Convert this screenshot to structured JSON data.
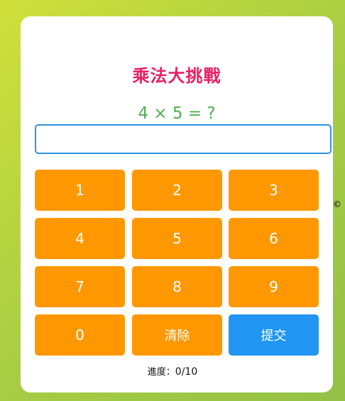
{
  "app": {
    "title": "乘法大挑戰"
  },
  "question": {
    "text": "4 × 5 = ?"
  },
  "answer_input": {
    "value": "",
    "placeholder": ""
  },
  "keypad": {
    "keys": [
      "1",
      "2",
      "3",
      "4",
      "5",
      "6",
      "7",
      "8",
      "9",
      "0"
    ],
    "clear_label": "清除",
    "submit_label": "提交"
  },
  "progress": {
    "label": "進度：",
    "value": "0/10"
  },
  "edge_mark": "©",
  "colors": {
    "title": "#e91e63",
    "question": "#4caf50",
    "key": "#ff9800",
    "submit": "#2196f3",
    "input_border": "#2f93e0"
  }
}
